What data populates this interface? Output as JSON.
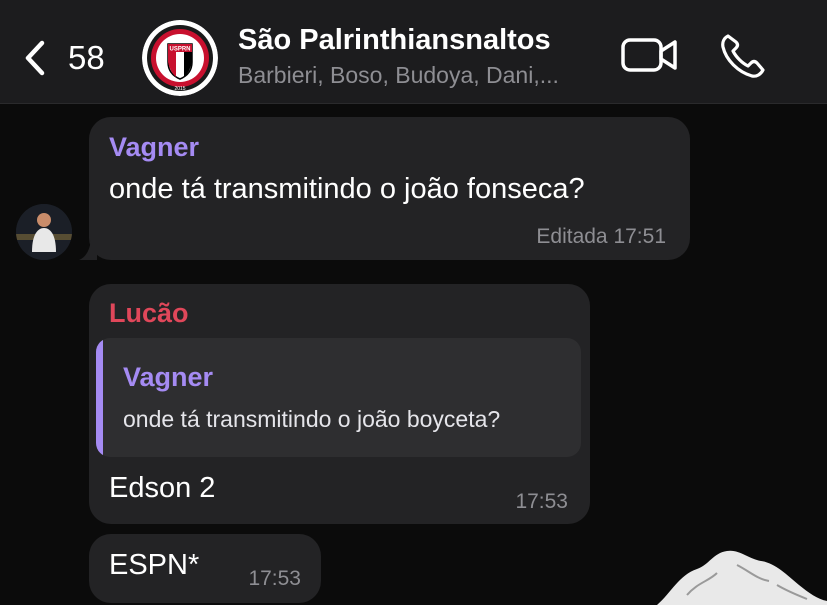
{
  "header": {
    "back_count": "58",
    "group_name": "São Palrinthiansnaltos",
    "members": "Barbieri, Boso, Budoya, Dani,...",
    "logo_text": "USPRN",
    "logo_ring_text": "UNIÃO SÃO PALRINTHIANS",
    "logo_year": "2015"
  },
  "colors": {
    "vagner": "#a58bf3",
    "lucao": "#e0475a",
    "bubble": "#232325",
    "quote_bg": "#2e2e30"
  },
  "messages": [
    {
      "sender": "Vagner",
      "text": "onde tá transmitindo o joão fonseca?",
      "time": "Editada 17:51"
    },
    {
      "sender": "Lucão",
      "quote_sender": "Vagner",
      "quote_text": "onde tá transmitindo o joão boyceta?",
      "text": "Edson 2",
      "time": "17:53"
    },
    {
      "text": "ESPN*",
      "time": "17:53"
    }
  ],
  "icons": {
    "back": "chevron-left-icon",
    "video": "video-camera-icon",
    "call": "phone-icon"
  }
}
